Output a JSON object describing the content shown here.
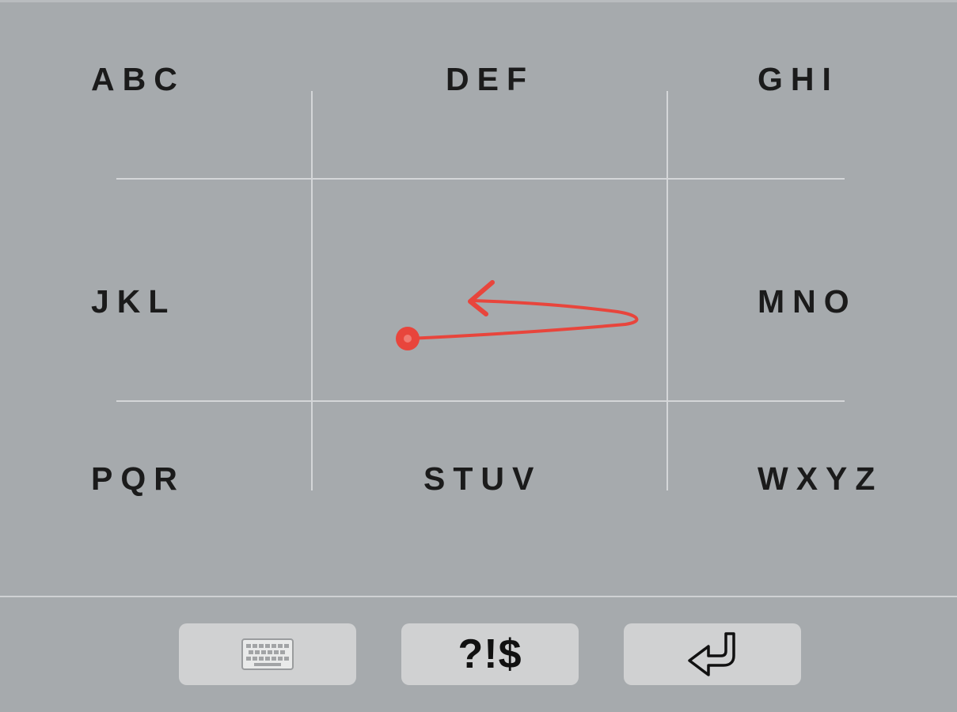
{
  "keyboard": {
    "keys": {
      "abc": "ABC",
      "def": "DEF",
      "ghi": "GHI",
      "jkl": "JKL",
      "mno": "MNO",
      "pqr": "PQR",
      "stuv": "STUV",
      "wxyz": "WXYZ"
    },
    "bottom_bar": {
      "keyboard_switch_icon": "keyboard-icon",
      "symbols_label": "?!$",
      "enter_icon": "enter-return-icon"
    }
  },
  "gesture": {
    "icon": "swipe-left-arrow",
    "color": "#e8453c"
  },
  "colors": {
    "background": "#a6aaad",
    "key_text": "#1b1b1b",
    "button_bg": "#d0d1d2"
  }
}
